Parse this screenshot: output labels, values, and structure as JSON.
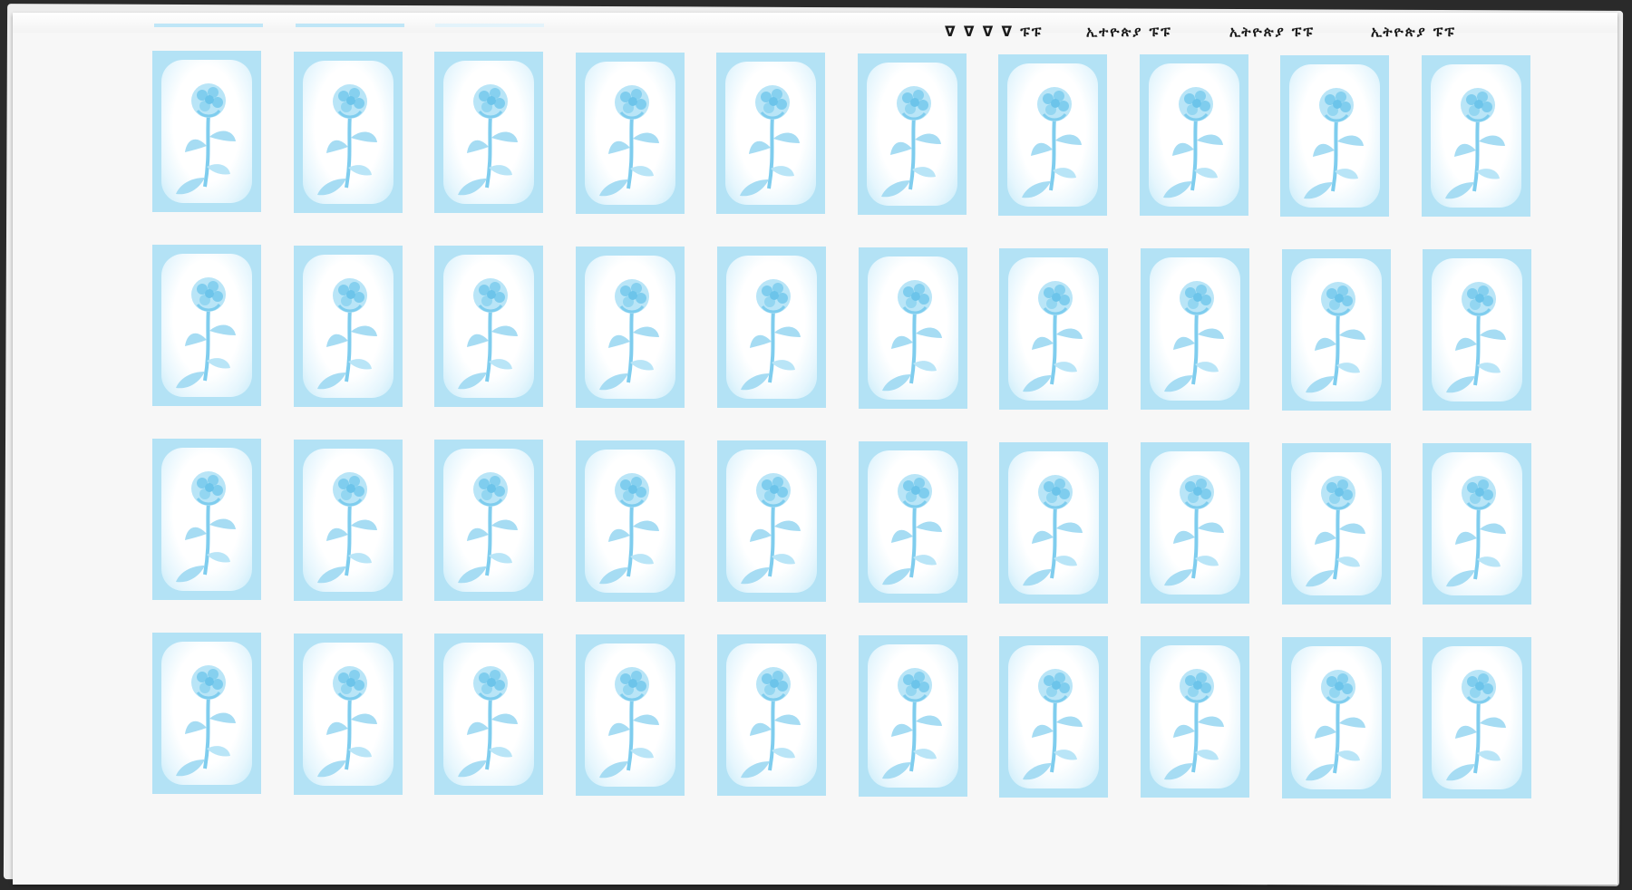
{
  "sheet": {
    "paper_color": "#f7f7f7",
    "ink_color": "#7fcdee",
    "header_labels": [
      "ᐁ ᐁ ᐁ ᐁ ፑፑ",
      "ኢተዮጵያ ፑፑ",
      "ኢትዮጵያ ፑፑ",
      "ኢትዮጵያ ፑፑ"
    ]
  },
  "stamp_block": {
    "rows": 4,
    "columns": 10,
    "motif": "flower-icon",
    "print_color": "#b3e2f5"
  }
}
